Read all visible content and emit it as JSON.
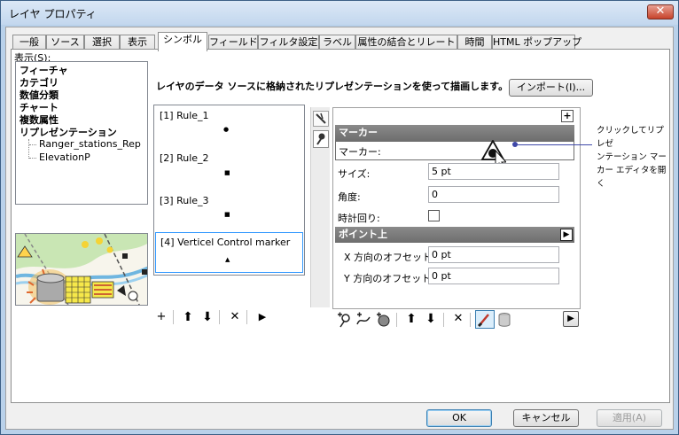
{
  "window": {
    "title": "レイヤ プロパティ",
    "close_glyph": "✕"
  },
  "tabs": [
    "一般",
    "ソース",
    "選択",
    "表示",
    "シンボル",
    "フィールド",
    "フィルタ設定",
    "ラベル",
    "属性の結合とリレート",
    "時間",
    "HTML ポップアップ"
  ],
  "active_tab": "シンボル",
  "show_label": "表示(S):",
  "tree": {
    "bold_items": [
      "フィーチャ",
      "カテゴリ",
      "数値分類",
      "チャート",
      "複数属性",
      "リプレゼンテーション"
    ],
    "sub_items": [
      "Ranger_stations_Rep",
      "ElevationP"
    ]
  },
  "description": "レイヤのデータ ソースに格納されたリプレゼンテーションを使って描画します。",
  "import_button": "インポート(I)...",
  "rules": [
    {
      "label": "[1] Rule_1",
      "symbol": "●"
    },
    {
      "label": "[2] Rule_2",
      "symbol": "■"
    },
    {
      "label": "[3] Rule_3",
      "symbol": "■"
    },
    {
      "label": "[4] Verticel Control marker",
      "symbol": "▲"
    }
  ],
  "rule_toolbar": {
    "add": "+",
    "up": "⬆",
    "down": "⬇",
    "remove": "✕",
    "more": "▶"
  },
  "panel": {
    "plus_glyph": "+",
    "marker_section": "マーカー",
    "marker_label": "マーカー:",
    "size_label": "サイズ:",
    "size_value": "5 pt",
    "angle_label": "角度:",
    "angle_value": "0",
    "clockwise_label": "時計回り:",
    "point_section": "ポイント上",
    "x_offset_label": "X 方向のオフセット:",
    "x_offset_value": "0 pt",
    "y_offset_label": "Y 方向のオフセット:",
    "y_offset_value": "0 pt"
  },
  "callout": "クリックしてリプレゼンテーション マーカー エディタを開く",
  "callout_lines": [
    "クリックしてリプレゼ",
    "ンテーション マー",
    "カー エディタを開く"
  ],
  "footer": {
    "ok": "OK",
    "cancel": "キャンセル",
    "apply": "適用(A)"
  },
  "colors": {
    "section_bg": "#7b7b7b",
    "accent": "#3c7fb1",
    "callout_line": "#3f48a8"
  }
}
